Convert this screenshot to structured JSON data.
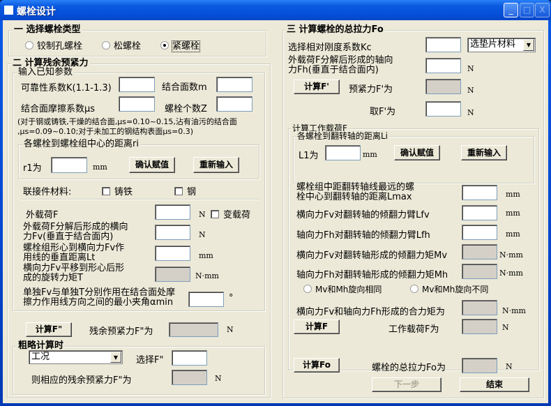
{
  "window": {
    "title": "螺栓设计",
    "minimize": "_",
    "maximize": "□",
    "close": "X"
  },
  "s1": {
    "title": "一 选择螺栓类型",
    "options": [
      "铰制孔螺栓",
      "松螺栓",
      "紧螺栓"
    ],
    "selected": "紧螺栓"
  },
  "s2": {
    "title": "二 计算残余预紧力",
    "known": {
      "title": "输入已知参数",
      "k_label": "可靠性系数K(1.1-1.3)",
      "m_label": "结合面数m",
      "mu_label": "结合面摩擦系数μs",
      "z_label": "螺栓个数Z",
      "note1": "(对于钢或铸铁,干燥的结合面,μs=0.10~0.15,沾有油污的结合面",
      "note2": ",μs=0.09~0.10;对于未加工的钢结构表面μs=0.3)",
      "ri": {
        "title": "各螺栓到螺栓组中心的距离ri",
        "r1_label": "r1为",
        "unit": "mm",
        "confirm": "确认赋值",
        "reenter": "重新输入"
      },
      "material_label": "联接件材料:",
      "cast_iron": "铸铁",
      "steel": "钢",
      "F_label": "外载荷F",
      "F_unit": "N",
      "variable_load": "变载荷",
      "Fv_label1": "外载荷F分解后形成的横向",
      "Fv_label2": "力Fv(垂直于结合面内)",
      "Fv_unit": "N",
      "Lt_label1": "螺栓组形心到横向力Fv作",
      "Lt_label2": "用线的垂直距离Lt",
      "Lt_unit": "mm",
      "T_label1": "横向力Fv平移到形心后形",
      "T_label2": "成的旋转力矩T",
      "T_unit": "N·mm",
      "alpha_label1": "单独Fv与单独T分别作用在结合面处摩",
      "alpha_label2": "擦力作用线方向之间的最小夹角αmin",
      "alpha_unit": "°"
    },
    "calc_button": "计算F\"",
    "residual_label": "残余预紧力F\"为",
    "residual_unit": "N",
    "rough": {
      "title": "粗略计算时",
      "condition_value": "工况",
      "select_label": "选择F\"",
      "result_label": "则相应的残余预紧力F\"为",
      "unit": "N"
    }
  },
  "s3": {
    "title": "三 计算螺栓的总拉力Fo",
    "kc_label": "选择相对刚度系数Kc",
    "gasket_value": "选垫片材料",
    "Fh_label1": "外载荷F分解后形成的轴向",
    "Fh_label2": "力Fh(垂直于结合面内)",
    "Fh_unit": "N",
    "calc_pre_button": "计算F'",
    "pre_label": "预紧力F'为",
    "pre_unit": "N",
    "take_label": "取F'为",
    "take_unit": "N",
    "work": {
      "title": "计算工作载荷F",
      "li": {
        "title": "各螺栓到翻转轴的距离Li",
        "l1_label": "L1为",
        "unit": "mm",
        "confirm": "确认赋值",
        "reenter": "重新输入"
      },
      "lmax_label1": "螺栓组中距翻转轴线最远的螺",
      "lmax_label2": "栓中心到翻转轴的距离Lmax",
      "lmax_unit": "mm",
      "lfv_label": "横向力Fv对翻转轴的倾翻力臂Lfv",
      "lfv_unit": "mm",
      "lfh_label": "轴向力Fh对翻转轴的倾翻力臂Lfh",
      "lfh_unit": "mm",
      "mv_label": "横向力Fv对翻转轴形成的倾翻力矩Mv",
      "mv_unit": "N·mm",
      "mh_label": "轴向力Fh对翻转轴形成的倾翻力矩Mh",
      "mh_unit": "N·mm",
      "same_dir": "Mv和Mh旋向相同",
      "diff_dir": "Mv和Mh旋向不同",
      "resultant_label": "横向力Fv和轴向力Fh形成的合力矩为",
      "resultant_unit": "N·mm",
      "calc_F_button": "计算F",
      "F_label": "工作载荷F为",
      "F_unit": "N"
    },
    "calc_Fo_button": "计算Fo",
    "Fo_label": "螺栓的总拉力Fo为",
    "Fo_unit": "N",
    "next": "下一步",
    "finish": "结束"
  }
}
